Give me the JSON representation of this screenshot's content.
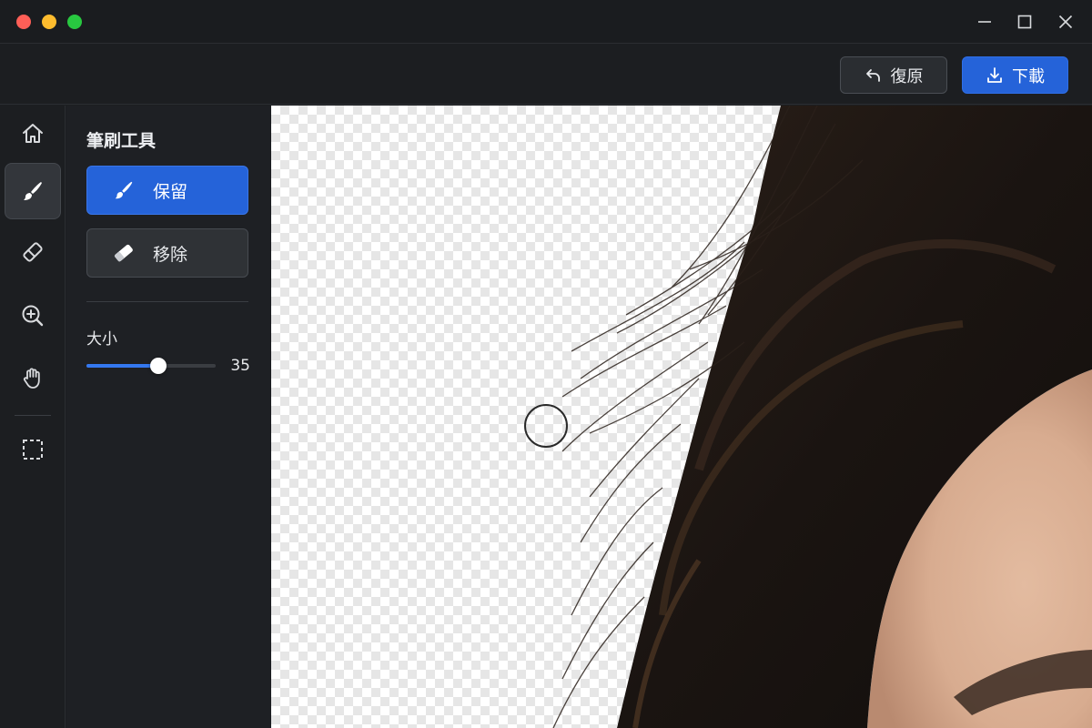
{
  "window": {
    "controls": {
      "close_color": "#ff5f57",
      "minimize_color": "#febc2e",
      "zoom_color": "#28c840"
    },
    "buttons": [
      "minimize-icon",
      "maximize-icon",
      "close-icon"
    ]
  },
  "toolbar": {
    "undo_label": "復原",
    "undo_icon": "undo-arrow-icon",
    "download_label": "下載",
    "download_icon": "download-icon",
    "accent_color": "#2563d9"
  },
  "rail": {
    "items": [
      {
        "icon": "home-icon",
        "active": false
      },
      {
        "icon": "brush-icon",
        "active": true
      },
      {
        "icon": "eraser-icon",
        "active": false
      },
      {
        "icon": "zoom-in-icon",
        "active": false
      },
      {
        "icon": "hand-icon",
        "active": false
      },
      {
        "icon": "selection-icon",
        "active": false
      }
    ]
  },
  "panel": {
    "title": "筆刷工具",
    "modes": [
      {
        "label": "保留",
        "icon": "brush-icon",
        "selected": true
      },
      {
        "label": "移除",
        "icon": "eraser-icon",
        "selected": false
      }
    ],
    "size": {
      "label": "大小",
      "value": 35,
      "display": "35",
      "min": 0,
      "max": 63
    }
  },
  "canvas": {
    "background": "transparency-checkerboard",
    "content": "hair-cutout-photo",
    "cursor": "brush-circle-cursor"
  }
}
